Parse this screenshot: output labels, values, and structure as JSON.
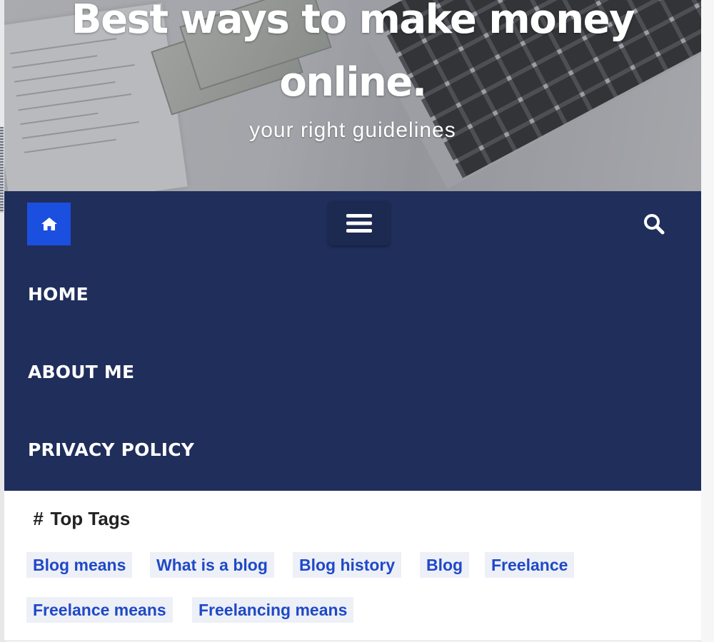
{
  "header": {
    "title": "Best ways to make money online.",
    "title_line1": "Best ways to make money",
    "title_line2": "online.",
    "tagline": "your right guidelines"
  },
  "nav": {
    "home_icon": "home-icon",
    "menu_icon": "hamburger-menu-icon",
    "search_icon": "search-icon",
    "items": [
      {
        "label": "HOME"
      },
      {
        "label": "ABOUT ME"
      },
      {
        "label": "PRIVACY POLICY"
      }
    ]
  },
  "tags_widget": {
    "icon": "hash-icon",
    "title": "Top Tags",
    "tags": [
      {
        "label": "Blog means"
      },
      {
        "label": "What is a blog"
      },
      {
        "label": "Blog history"
      },
      {
        "label": "Blog"
      },
      {
        "label": "Freelance"
      },
      {
        "label": "Freelance means"
      },
      {
        "label": "Freelancing means"
      }
    ]
  },
  "colors": {
    "nav_background": "#202e5b",
    "home_button": "#1b4fe0",
    "tag_text": "#1f49c8",
    "tag_background": "#eef0f7"
  }
}
